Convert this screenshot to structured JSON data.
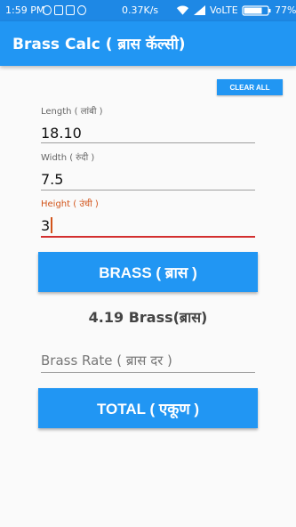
{
  "status_bar": {
    "time": "1:59 PM",
    "network_speed": "0.37K/s",
    "carrier": "VoLTE",
    "battery": "77%",
    "notification_icons": [
      "messenger-icon",
      "sim-card-icon",
      "app-icon",
      "whatsapp-icon"
    ]
  },
  "app_bar": {
    "title": "Brass Calc ( ब्रास कॅल्सी)",
    "color": "#2196f3"
  },
  "clear_all_label": "CLEAR ALL",
  "fields": {
    "length": {
      "label": "Length ( लांबी )",
      "value": "18.10"
    },
    "width": {
      "label": "Width ( रुंदी )",
      "value": "7.5"
    },
    "height": {
      "label": "Height ( उंची )",
      "value": "3",
      "focused": true
    },
    "brass_rate": {
      "placeholder": "Brass Rate ( ब्रास दर )",
      "value": ""
    }
  },
  "brass_button_label": "BRASS ( ब्रास )",
  "result_text": "4.19 Brass(ब्रास)",
  "total_button_label": "TOTAL ( एकूण )",
  "colors": {
    "accent": "#2196f3",
    "status_bar": "#1e88e5",
    "focus": "#d32f2f"
  }
}
